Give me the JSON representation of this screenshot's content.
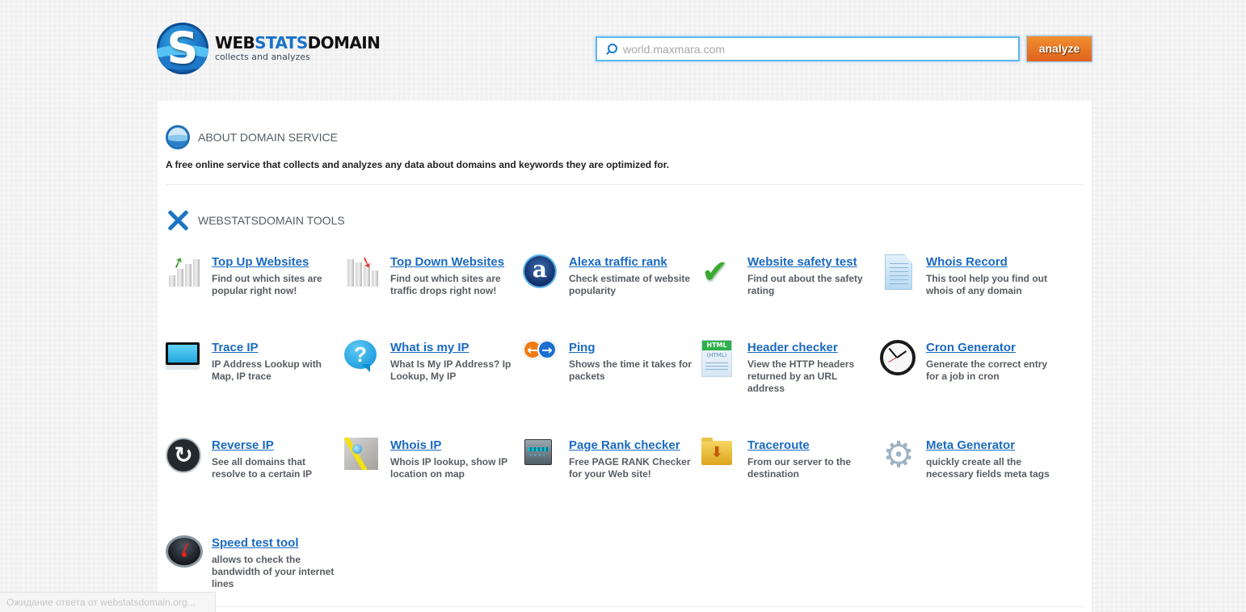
{
  "header": {
    "logo": {
      "letter": "S",
      "title_part1": "WEB",
      "title_part2": "STATS",
      "title_part3": "DOMAIN",
      "tagline": "collects and analyzes"
    },
    "search": {
      "placeholder": "world.maxmara.com",
      "value": ""
    },
    "analyze_label": "analyze",
    "colors": {
      "accent": "#1a6ac2",
      "button": "#e8761f",
      "search_border": "#61b6ef"
    }
  },
  "about": {
    "title": "ABOUT DOMAIN SERVICE",
    "text": "A free online service that collects and analyzes any data about domains and keywords they are optimized for."
  },
  "tools_section": {
    "title": "WEBSTATSDOMAIN TOOLS",
    "tools": [
      {
        "name": "Top Up Websites",
        "desc": "Find out which sites are popular right now!",
        "icon": "chart-up-icon"
      },
      {
        "name": "Top Down Websites",
        "desc": "Find out which sites are traffic drops right now!",
        "icon": "chart-down-icon"
      },
      {
        "name": "Alexa traffic rank",
        "desc": "Check estimate of website popularity",
        "icon": "alexa-icon"
      },
      {
        "name": "Website safety test",
        "desc": "Find out about the safety rating",
        "icon": "checkmark-icon"
      },
      {
        "name": "Whois Record",
        "desc": "This tool help you find out whois of any domain",
        "icon": "document-icon"
      },
      {
        "name": "Trace IP",
        "desc": "IP Address Lookup with Map, IP trace",
        "icon": "monitor-icon"
      },
      {
        "name": "What is my IP",
        "desc": "What Is My IP Address? Ip Lookup, My IP",
        "icon": "question-icon"
      },
      {
        "name": "Ping",
        "desc": "Shows the time it takes for packets",
        "icon": "ping-arrows-icon"
      },
      {
        "name": "Header checker",
        "desc": "View the HTTP headers returned by an URL address",
        "icon": "html-document-icon"
      },
      {
        "name": "Cron Generator",
        "desc": "Generate the correct entry for a job in cron",
        "icon": "clock-icon"
      },
      {
        "name": "Reverse IP",
        "desc": "See all domains that resolve to a certain IP",
        "icon": "reverse-arrow-icon"
      },
      {
        "name": "Whois IP",
        "desc": "Whois IP lookup, show IP location on map",
        "icon": "map-icon"
      },
      {
        "name": "Page Rank checker",
        "desc": "Free PAGE RANK Checker for your Web site!",
        "icon": "progress-device-icon"
      },
      {
        "name": "Traceroute",
        "desc": "From our server to the destination",
        "icon": "folder-download-icon"
      },
      {
        "name": "Meta Generator",
        "desc": "quickly create all the necessary fields meta tags",
        "icon": "gear-icon"
      },
      {
        "name": "Speed test tool",
        "desc": "allows to check the bandwidth of your internet lines",
        "icon": "speedometer-icon"
      }
    ]
  },
  "icon_glyphs": {
    "arrow_up": "➚",
    "arrow_down": "➘",
    "alexa": "a",
    "check": "✔",
    "question": "?",
    "ping_left": "←",
    "ping_right": "→",
    "html_tag": "HTML",
    "html_inner": "(HTML)",
    "reverse": "↻",
    "folder_arrow": "⬇",
    "gear": "⚙"
  },
  "statusbar": {
    "text": "Ожидание ответа от webstatsdomain.org..."
  }
}
